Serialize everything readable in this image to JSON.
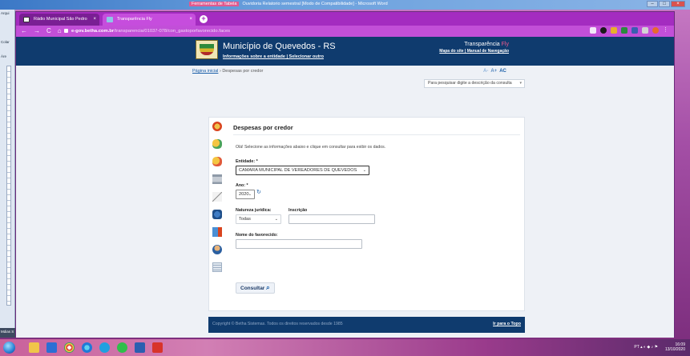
{
  "word": {
    "title_tag": "Ferramentas de Tabela",
    "doc_title": "Ouvidoria Relatorio semestral [Modo de Compatibilidade] - Microsoft Word",
    "left_labels": [
      "Arqui",
      "Colar",
      "Áre"
    ],
    "status": "Página",
    "status2": "Mdias S"
  },
  "browser": {
    "tabs": [
      {
        "label": "Rádio Municipal São Pedro",
        "close": "×"
      },
      {
        "label": "Transparência Fly",
        "close": "×"
      }
    ],
    "new_tab": "+",
    "nav": {
      "back": "←",
      "forward": "→",
      "reload": "C",
      "home": "⌂"
    },
    "url_host": "e-gov.betha.com.br",
    "url_path": "/transparencia/01037-078/con_gastoporfavorecido.faces"
  },
  "header": {
    "municipality": "Município de Quevedos - RS",
    "muni_links": "Informações sobre a entidade | Selecionar outro",
    "portal_name": "Transparência ",
    "portal_fly": "Fly",
    "portal_links": "Mapa do site | Manual de Navegação"
  },
  "breadcrumb": {
    "home": "Página inicial",
    "sep": "›",
    "current": "Despesas por credor"
  },
  "font_controls": {
    "smaller": "A-",
    "normal": "A+",
    "contrast": "AC"
  },
  "search": {
    "placeholder": "Para pesquisar digite a descrição da consulta"
  },
  "form": {
    "title": "Despesas por credor",
    "intro": "Olá! Selecione as informações abaixo e clique em consultar para exibir os dados.",
    "entity_label": "Entidade: *",
    "entity_value": "CAMARA MUNICIPAL DE VEREADORES DE QUEVEDOS",
    "year_label": "Ano: *",
    "year_value": "2020",
    "nature_label": "Natureza jurídica:",
    "nature_value": "Todas",
    "registration_label": "Inscrição",
    "registration_value": "",
    "payee_label": "Nome do favorecido:",
    "payee_value": "",
    "submit": "Consultar"
  },
  "footer": {
    "copyright": "Copyright © Betha Sistemas. Todos os direitos reservados desde 1985",
    "top_link": "Ir para o Topo"
  },
  "taskbar": {
    "tray": "PT",
    "time": "16:09",
    "date": "13/10/2020"
  }
}
